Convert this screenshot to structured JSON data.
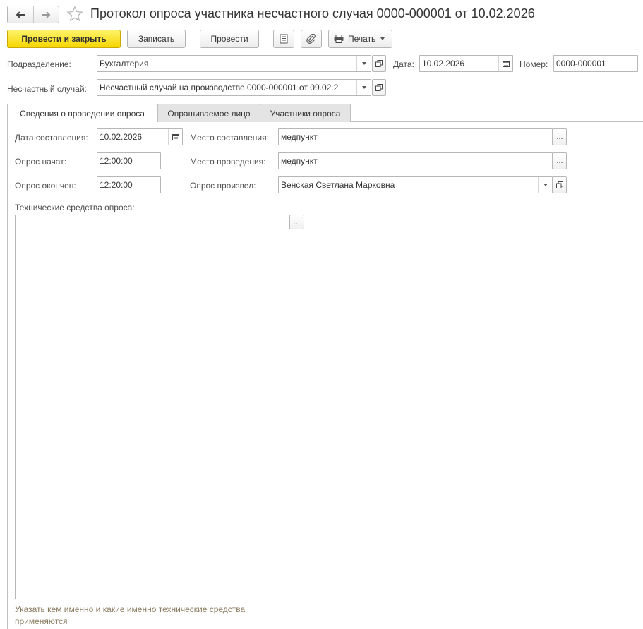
{
  "header": {
    "title": "Протокол опроса участника несчастного случая 0000-000001 от 10.02.2026"
  },
  "toolbar": {
    "post_and_close": "Провести и закрыть",
    "save": "Записать",
    "post": "Провести",
    "print": "Печать"
  },
  "form": {
    "department_label": "Подразделение:",
    "department_value": "Бухгалтерия",
    "date_label": "Дата:",
    "date_value": "10.02.2026",
    "number_label": "Номер:",
    "number_value": "0000-000001",
    "accident_label": "Несчастный случай:",
    "accident_value": "Несчастный случай на производстве 0000-000001 от 09.02.2"
  },
  "tabs": [
    {
      "label": "Сведения о проведении опроса",
      "active": true
    },
    {
      "label": "Опрашиваемое лицо",
      "active": false
    },
    {
      "label": "Участники опроса",
      "active": false
    }
  ],
  "tab_content": {
    "compile_date_label": "Дата составления:",
    "compile_date_value": "10.02.2026",
    "compile_place_label": "Место составления:",
    "compile_place_value": "медпункт",
    "start_label": "Опрос начат:",
    "start_value": "12:00:00",
    "venue_label": "Место проведения:",
    "venue_value": "медпункт",
    "end_label": "Опрос окончен:",
    "end_value": "12:20:00",
    "conducted_by_label": "Опрос произвел:",
    "conducted_by_value": "Венская Светлана Марковна",
    "tech_means_label": "Технические средства опроса:",
    "tech_means_value": "",
    "tech_means_hint": "Указать кем именно и какие именно технические средства применяются",
    "ellipsis": "..."
  },
  "colors": {
    "primary_button": "#f6d600",
    "hint_text": "#8a7a5e",
    "border": "#b7b7b7"
  }
}
